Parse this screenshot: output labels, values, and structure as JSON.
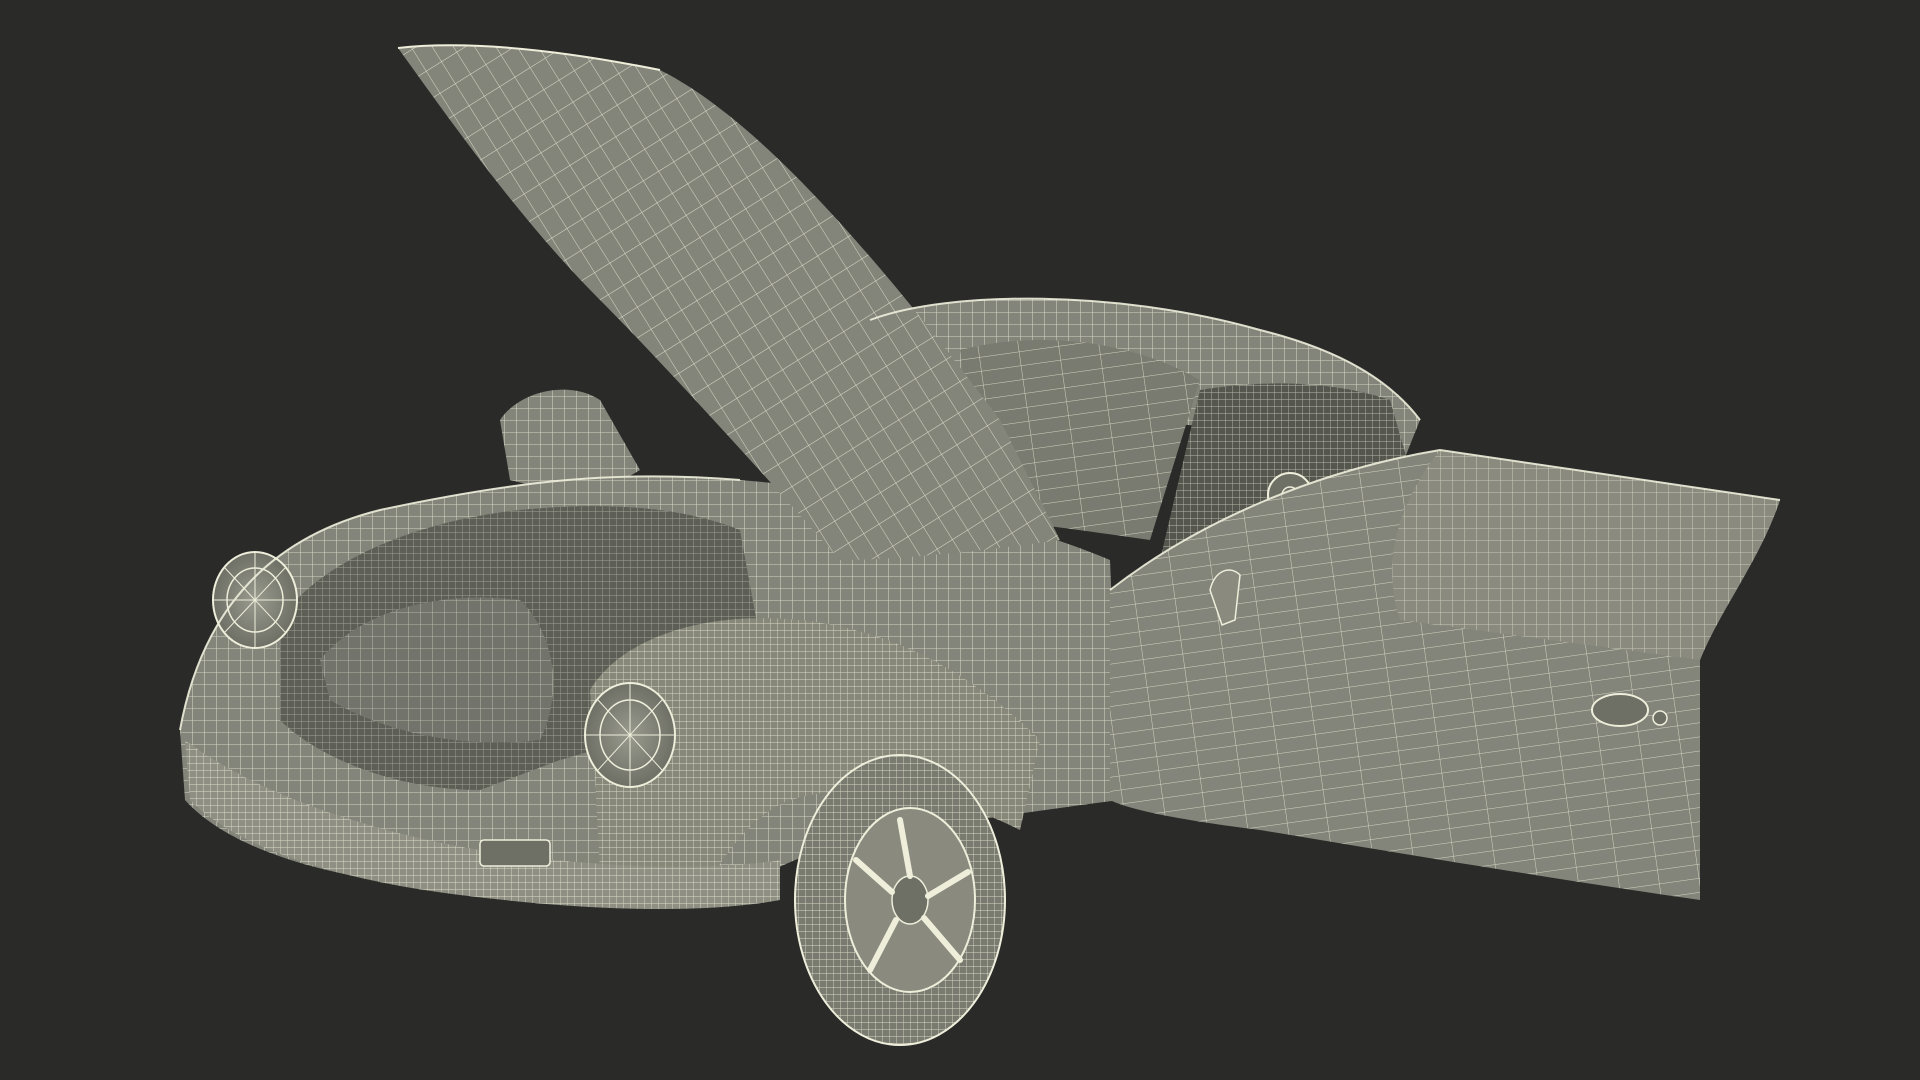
{
  "scene": {
    "subject": "wireframe-car-model",
    "colors": {
      "background": "#2a2a29",
      "surface": "#84857a",
      "surface_dark": "#6e6f65",
      "surface_light": "#9a9b8f",
      "interior": "#55574f",
      "wire": "#eeeedb",
      "wire_faint": "#d8d9c4"
    }
  }
}
